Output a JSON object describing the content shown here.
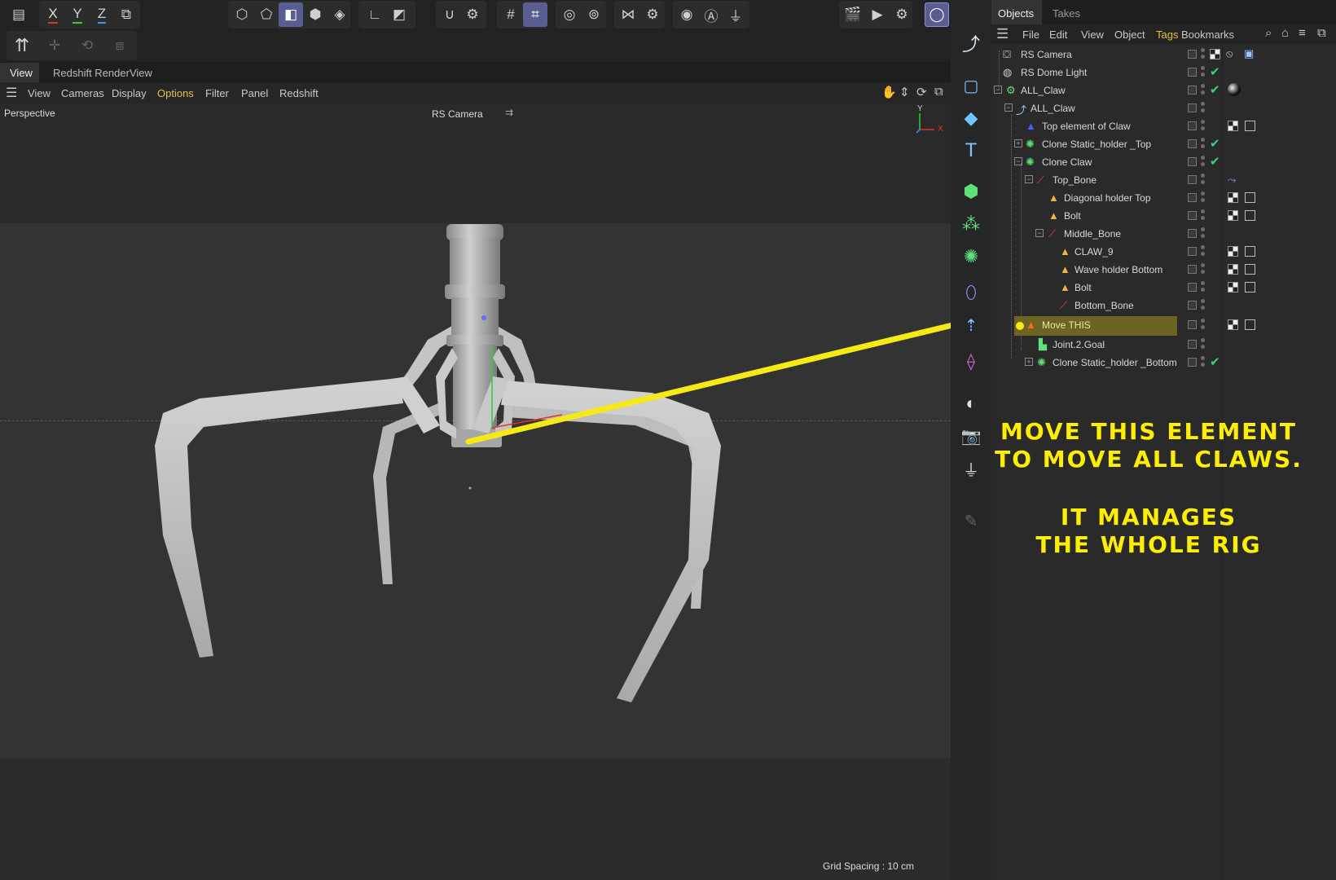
{
  "toolbar": {
    "axis_x": "X",
    "axis_y": "Y",
    "axis_z": "Z"
  },
  "viewport": {
    "tabs": [
      "View",
      "Redshift RenderView"
    ],
    "menu": [
      "View",
      "Cameras",
      "Display",
      "Options",
      "Filter",
      "Panel",
      "Redshift"
    ],
    "active_menu": "Options",
    "projection": "Perspective",
    "camera": "RS Camera",
    "grid_spacing": "Grid Spacing : 10 cm",
    "axis_y_label": "Y",
    "axis_x_label": "X"
  },
  "objects_panel": {
    "tabs": [
      "Objects",
      "Takes"
    ],
    "menu": [
      "File",
      "Edit",
      "View",
      "Object",
      "Tags",
      "Bookmarks"
    ],
    "active_menu": "Tags",
    "rows": [
      {
        "label": "RS Camera"
      },
      {
        "label": "RS Dome Light"
      },
      {
        "label": "ALL_Claw"
      },
      {
        "label": "ALL_Claw"
      },
      {
        "label": "Top element of Claw"
      },
      {
        "label": "Clone Static_holder _Top"
      },
      {
        "label": "Clone Claw"
      },
      {
        "label": "Top_Bone"
      },
      {
        "label": "Diagonal  holder Top"
      },
      {
        "label": "Bolt"
      },
      {
        "label": "Middle_Bone"
      },
      {
        "label": "CLAW_9"
      },
      {
        "label": "Wave holder Bottom"
      },
      {
        "label": "Bolt"
      },
      {
        "label": "Bottom_Bone"
      },
      {
        "label": "Move THIS"
      },
      {
        "label": "Joint.2.Goal"
      },
      {
        "label": "Clone Static_holder _Bottom"
      }
    ]
  },
  "annotation": {
    "line1": "MOVE THIS ELEMENT",
    "line2": "TO MOVE ALL CLAWS.",
    "line3": "IT MANAGES",
    "line4": "THE WHOLE RIG"
  },
  "colors": {
    "accent": "#5a5d92",
    "annotation": "#ffee00",
    "highlight_row": "#6b6422",
    "check": "#37d67a"
  }
}
